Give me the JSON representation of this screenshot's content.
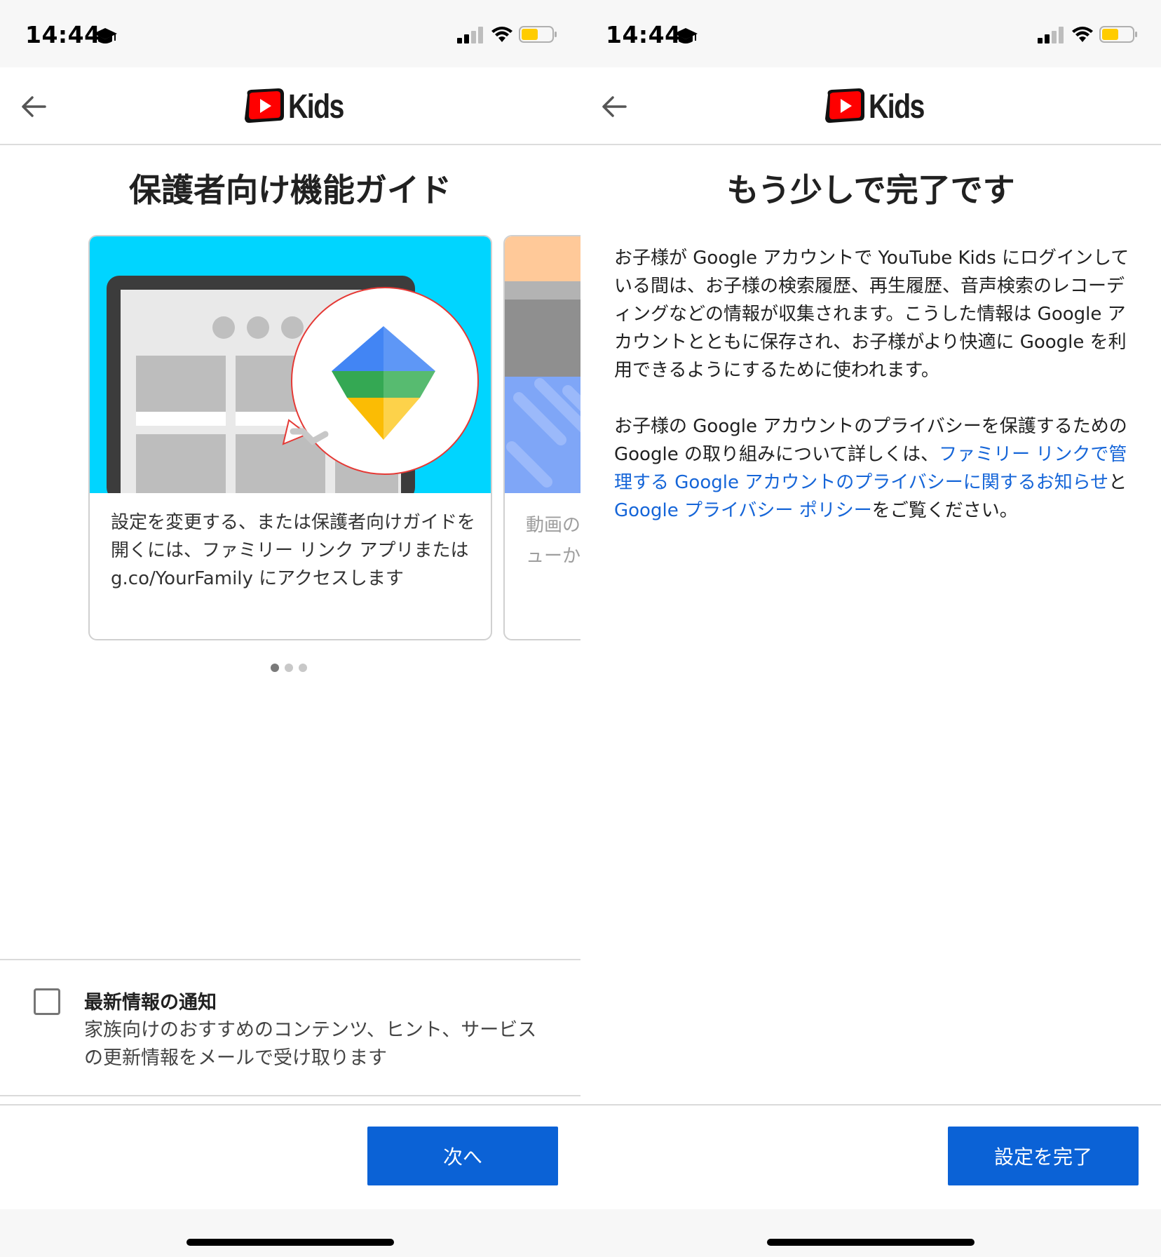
{
  "status_bar": {
    "time": "14:44"
  },
  "app": {
    "logo_text": "Kids"
  },
  "left": {
    "title": "保護者向け機能ガイド",
    "card": {
      "text": "設定を変更する、または保護者向けガイドを開くには、ファミリー リンク アプリまたは g.co/YourFamily にアクセスします"
    },
    "next_card": {
      "line1": "動画の",
      "line2": "ューか"
    },
    "pagination": {
      "current": 1,
      "total": 3
    },
    "notification": {
      "checked": false,
      "title": "最新情報の通知",
      "description": "家族向けのおすすめのコンテンツ、ヒント、サービスの更新情報をメールで受け取ります"
    },
    "next_button": "次へ"
  },
  "right": {
    "title": "もう少しで完了です",
    "paragraph1": "お子様が Google アカウントで YouTube Kids にログインしている間は、お子様の検索履歴、再生履歴、音声検索のレコーディングなどの情報が収集されます。こうした情報は Google アカウントとともに保存され、お子様がより快適に Google を利用できるようにするために使われます。",
    "paragraph2_prefix": "お子様の Google アカウントのプライバシーを保護するための Google の取り組みについて詳しくは、",
    "link1": "ファミリー リンクで管理する Google アカウントのプライバシーに関するお知らせ",
    "paragraph2_mid": "と ",
    "link2": "Google プライバシー ポリシー",
    "paragraph2_suffix": "をご覧ください。",
    "finish_button": "設定を完了"
  },
  "colors": {
    "primary_button": "#0b62d6",
    "link": "#1565d8",
    "youtube_red": "#ff0000",
    "battery_fill": "#ffcc00",
    "card_sky": "#00d5ff"
  }
}
